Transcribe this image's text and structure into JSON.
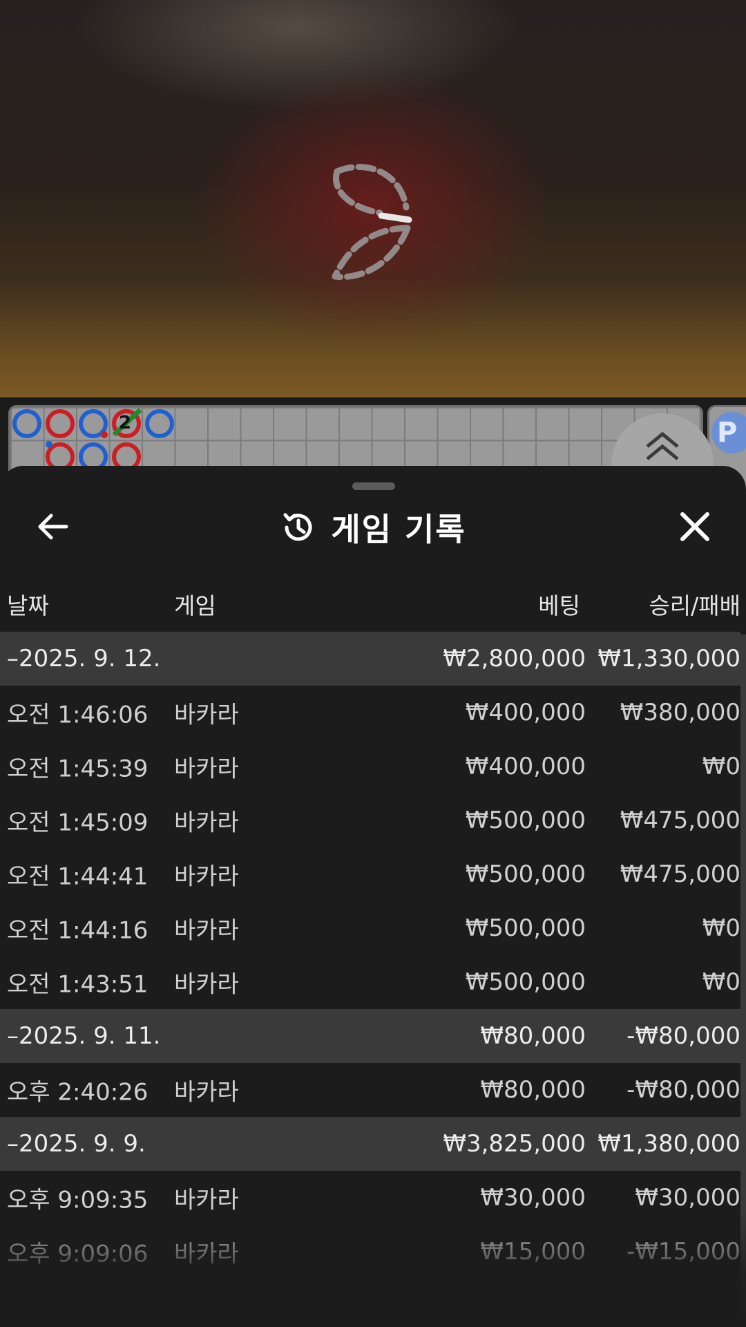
{
  "road": {
    "tie_count": "2",
    "side_badge": "P"
  },
  "header": {
    "title": "게임 기록"
  },
  "columns": {
    "date": "날짜",
    "game": "게임",
    "bet": "베팅",
    "result": "승리/패배"
  },
  "groups": [
    {
      "date": "–2025. 9. 12.",
      "bet": "₩2,800,000",
      "result": "₩1,330,000",
      "rows": [
        {
          "time": "오전 1:46:06",
          "game": "바카라",
          "bet": "₩400,000",
          "result": "₩380,000"
        },
        {
          "time": "오전 1:45:39",
          "game": "바카라",
          "bet": "₩400,000",
          "result": "₩0"
        },
        {
          "time": "오전 1:45:09",
          "game": "바카라",
          "bet": "₩500,000",
          "result": "₩475,000"
        },
        {
          "time": "오전 1:44:41",
          "game": "바카라",
          "bet": "₩500,000",
          "result": "₩475,000"
        },
        {
          "time": "오전 1:44:16",
          "game": "바카라",
          "bet": "₩500,000",
          "result": "₩0"
        },
        {
          "time": "오전 1:43:51",
          "game": "바카라",
          "bet": "₩500,000",
          "result": "₩0"
        }
      ]
    },
    {
      "date": "–2025. 9. 11.",
      "bet": "₩80,000",
      "result": "-₩80,000",
      "rows": [
        {
          "time": "오후 2:40:26",
          "game": "바카라",
          "bet": "₩80,000",
          "result": "-₩80,000"
        }
      ]
    },
    {
      "date": "–2025. 9. 9.",
      "bet": "₩3,825,000",
      "result": "₩1,380,000",
      "rows": [
        {
          "time": "오후 9:09:35",
          "game": "바카라",
          "bet": "₩30,000",
          "result": "₩30,000"
        },
        {
          "time": "오후 9:09:06",
          "game": "바카라",
          "bet": "₩15,000",
          "result": "-₩15,000"
        }
      ]
    }
  ],
  "colors": {
    "player_blue": "#1f5fd1",
    "banker_red": "#cc1e22",
    "tie_green": "#1f8a2e"
  }
}
